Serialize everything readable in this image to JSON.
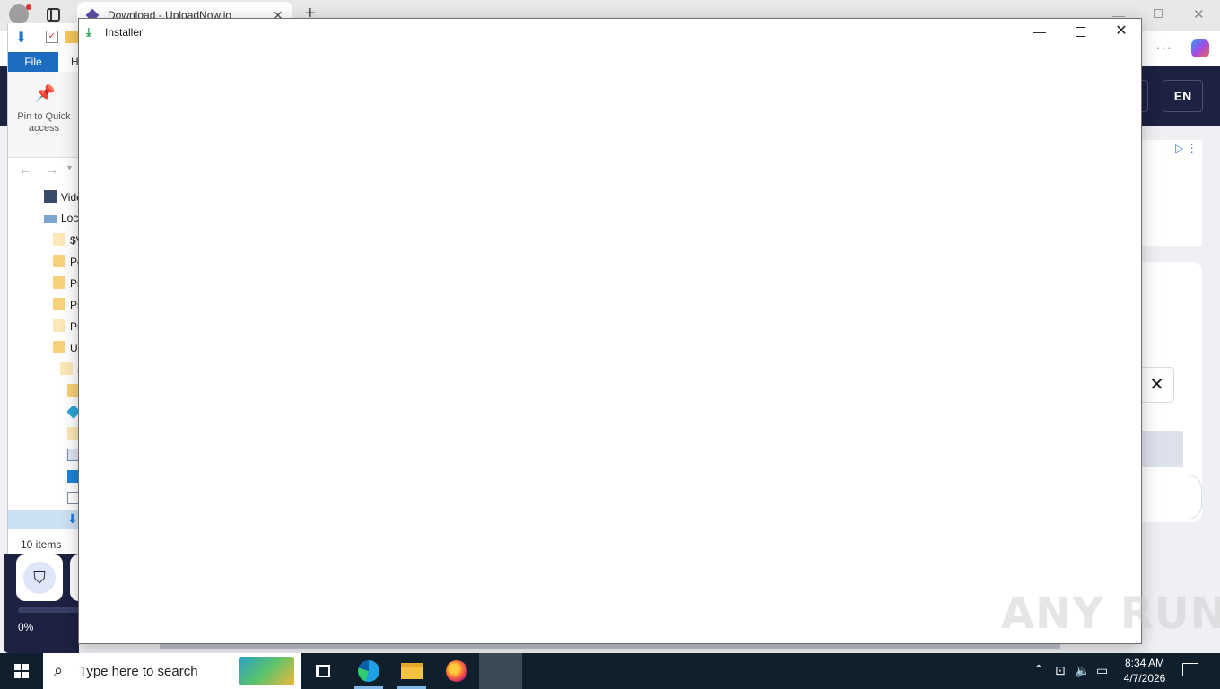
{
  "browser": {
    "tab_title": "Download - UploadNow.io",
    "new_tab": "+",
    "tab_close": "✕",
    "min": "—",
    "close": "✕",
    "more": "···"
  },
  "website": {
    "lang": "EN",
    "close_glyph": "✕",
    "progress_pct": "0%"
  },
  "explorer": {
    "file_tab": "File",
    "home_tab": "H",
    "pin_label": "Pin to Quick access",
    "tree": [
      "Vide",
      "Loc",
      "$V",
      "Pe",
      "Pr",
      "Pr",
      "Pr",
      "Us",
      "a",
      "",
      "",
      "",
      "",
      "",
      "",
      ""
    ],
    "status": "10 items"
  },
  "installer": {
    "title": "Installer",
    "min": "—",
    "close": "✕"
  },
  "watermark": "ANY RUN",
  "taskbar": {
    "search_placeholder": "Type here to search",
    "time": "8:34 AM",
    "date": "4/7/2026"
  }
}
